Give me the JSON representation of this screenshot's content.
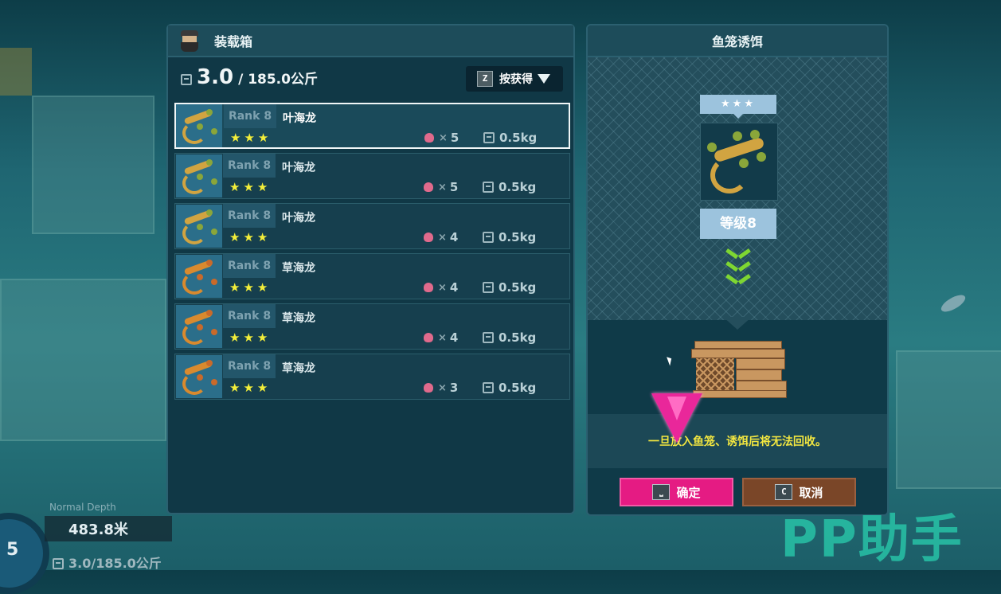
{
  "inventory": {
    "title": "装载箱",
    "weight_current": "3.0",
    "weight_max": "/ 185.0公斤",
    "sort_key": "Z",
    "sort_label": "按获得",
    "items": [
      {
        "rank": "Rank 8",
        "name": "叶海龙",
        "stars": "★★★",
        "bait": "5",
        "weight": "0.5kg",
        "kind": "leafy",
        "selected": true
      },
      {
        "rank": "Rank 8",
        "name": "叶海龙",
        "stars": "★★★",
        "bait": "5",
        "weight": "0.5kg",
        "kind": "leafy",
        "selected": false
      },
      {
        "rank": "Rank 8",
        "name": "叶海龙",
        "stars": "★★★",
        "bait": "4",
        "weight": "0.5kg",
        "kind": "leafy",
        "selected": false
      },
      {
        "rank": "Rank 8",
        "name": "草海龙",
        "stars": "★★★",
        "bait": "4",
        "weight": "0.5kg",
        "kind": "weedy",
        "selected": false
      },
      {
        "rank": "Rank 8",
        "name": "草海龙",
        "stars": "★★★",
        "bait": "4",
        "weight": "0.5kg",
        "kind": "weedy",
        "selected": false
      },
      {
        "rank": "Rank 8",
        "name": "草海龙",
        "stars": "★★★",
        "bait": "3",
        "weight": "0.5kg",
        "kind": "weedy",
        "selected": false
      }
    ]
  },
  "bait_panel": {
    "title": "鱼笼诱饵",
    "stars": "★★★",
    "level_label": "等级8",
    "warning": "一旦放入鱼笼、诱饵后将无法回收。",
    "confirm_key": "⎵",
    "confirm_label": "确定",
    "cancel_key": "C",
    "cancel_label": "取消"
  },
  "hud": {
    "depth_label": "Normal Depth",
    "depth_value": "483.8米",
    "ring_value": "5",
    "weight": "3.0/185.0公斤"
  },
  "watermark": "PP助手",
  "colors": {
    "leafy": "#d1a441",
    "weedy": "#d98a2e",
    "leaf_fin": "#8aa63a",
    "weed_fin": "#c96a2a",
    "accent_pink": "#e51b83",
    "star_yellow": "#f3ee3a",
    "warning_yellow": "#f2e640"
  },
  "icons": [
    "scale-icon",
    "heart-bait-icon",
    "chevron-down-icon",
    "trap-icon",
    "diver-avatar-icon"
  ]
}
